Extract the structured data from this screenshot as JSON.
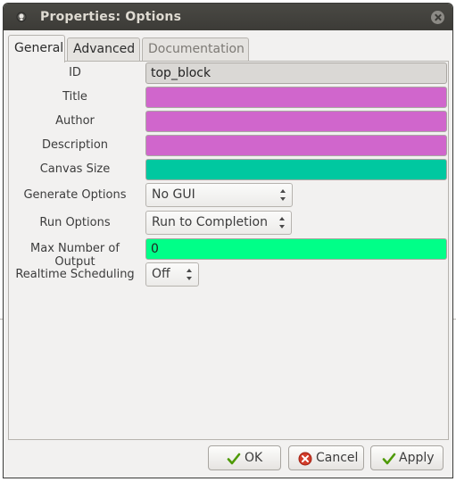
{
  "window": {
    "title": "Properties: Options"
  },
  "tabs": [
    {
      "label": "General"
    },
    {
      "label": "Advanced"
    },
    {
      "label": "Documentation"
    }
  ],
  "fields": {
    "id": {
      "label": "ID",
      "value": "top_block"
    },
    "title": {
      "label": "Title",
      "value": ""
    },
    "author": {
      "label": "Author",
      "value": ""
    },
    "description": {
      "label": "Description",
      "value": ""
    },
    "canvas_size": {
      "label": "Canvas Size",
      "value": ""
    },
    "generate_options": {
      "label": "Generate Options",
      "value": "No GUI"
    },
    "run_options": {
      "label": "Run Options",
      "value": "Run to Completion"
    },
    "max_outputs": {
      "label": "Max Number of Output",
      "value": "0"
    },
    "realtime": {
      "label": "Realtime Scheduling",
      "value": "Off"
    }
  },
  "buttons": {
    "ok": "OK",
    "cancel": "Cancel",
    "apply": "Apply"
  },
  "colors": {
    "string_field": "#d066cc",
    "vector_field": "#00c8a0",
    "int_field": "#00ff88",
    "id_field": "#dad8d5"
  },
  "icons": {
    "title": "window-app-icon",
    "close": "close-icon",
    "ok": "checkmark-icon",
    "cancel": "cancel-icon",
    "apply": "checkmark-icon"
  }
}
